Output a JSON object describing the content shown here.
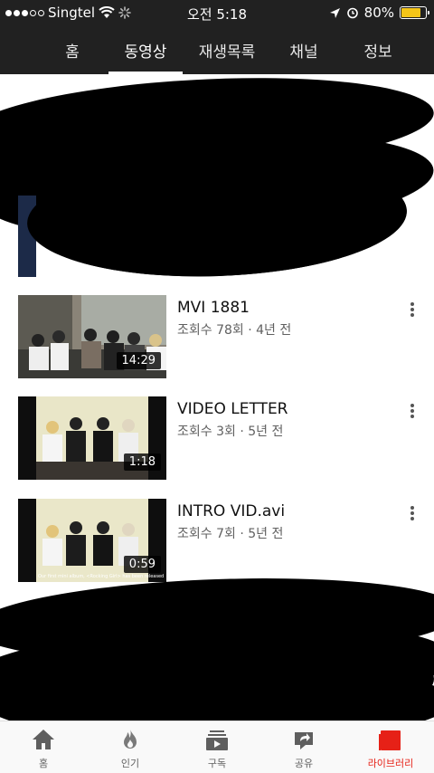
{
  "status_bar": {
    "carrier": "Singtel",
    "time": "오전 5:18",
    "battery": "80%",
    "battery_level": 0.8,
    "signal_icon": "signal-dots-icon",
    "wifi_icon": "wifi-icon",
    "loading_icon": "spinner-icon",
    "location_icon": "location-arrow-icon",
    "alarm_icon": "alarm-icon",
    "battery_color": "#f5c518"
  },
  "tabs": [
    {
      "label": "홈"
    },
    {
      "label": "동영상",
      "active": true
    },
    {
      "label": "재생목록"
    },
    {
      "label": "채널"
    },
    {
      "label": "정보"
    }
  ],
  "videos": [
    {
      "title": "MVI 1881",
      "meta": "조회수 78회 · 4년 전",
      "duration": "14:29"
    },
    {
      "title": "VIDEO LETTER",
      "meta": "조회수 3회 · 5년 전",
      "duration": "1:18"
    },
    {
      "title": "INTRO VID.avi",
      "meta": "조회수 7회 · 5년 전",
      "duration": "0:59",
      "caption": "Our first mini album, <Rocking Girl> has been released"
    }
  ],
  "bottom_nav": [
    {
      "label": "홈",
      "icon": "home-icon"
    },
    {
      "label": "인기",
      "icon": "flame-icon"
    },
    {
      "label": "구독",
      "icon": "subscriptions-icon"
    },
    {
      "label": "공유",
      "icon": "share-icon"
    },
    {
      "label": "라이브러리",
      "icon": "library-icon",
      "active": true
    }
  ],
  "colors": {
    "header_bg": "#212121",
    "active_red": "#e62117",
    "meta_gray": "#606060"
  }
}
